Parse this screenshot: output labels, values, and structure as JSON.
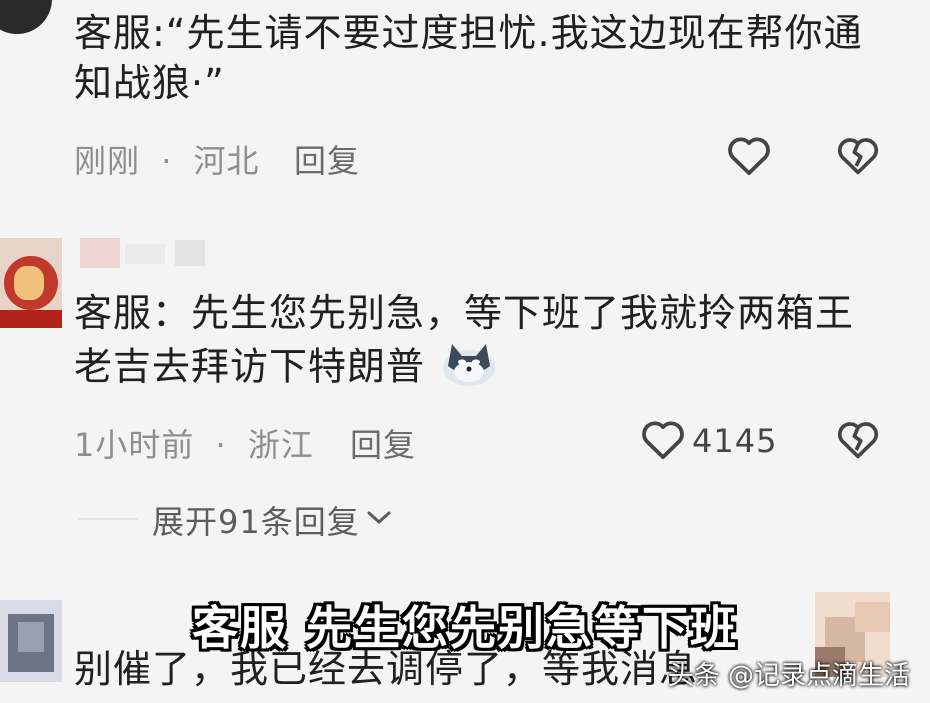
{
  "comment1": {
    "text_line1": "客服:“先生请不要过度担忧.我这边现在帮你通",
    "text_line2": "知战狼·”",
    "time": "刚刚",
    "sep": "·",
    "location": "河北",
    "reply_label": "回复"
  },
  "comment2": {
    "text_line1": "客服：先生您先别急，等下班了我就拎两箱王",
    "text_line2": "老吉去拜访下特朗普",
    "time": "1小时前",
    "sep": "·",
    "location": "浙江",
    "reply_label": "回复",
    "like_count": "4145",
    "expand_label": "展开91条回复"
  },
  "comment3": {
    "text_line1": "别催了，我已经去调停了，等我消息"
  },
  "overlay": {
    "subtitle": "客服 先生您先别急等下班",
    "watermark": "头条 @记录点滴生活"
  },
  "icons": {
    "like": "heart-outline-icon",
    "dislike": "broken-heart-icon",
    "expand": "chevron-down-icon",
    "emoji": "wolf-emoji-icon"
  }
}
